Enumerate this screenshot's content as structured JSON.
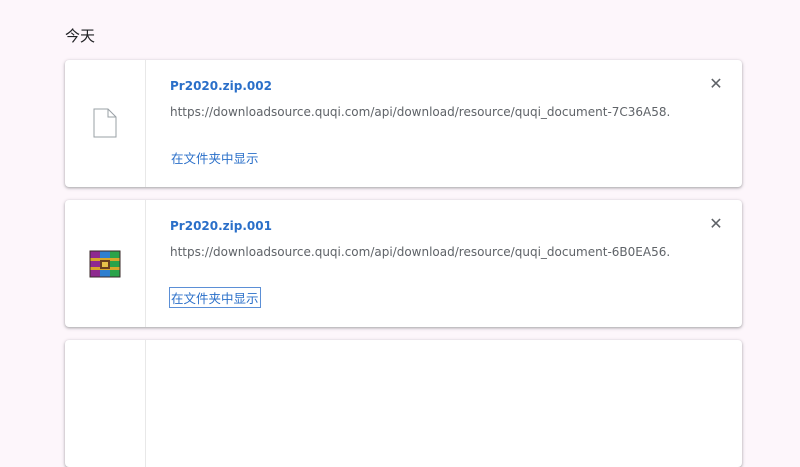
{
  "section": {
    "title": "今天"
  },
  "downloads": [
    {
      "file_name": "Pr2020.zip.002",
      "url": "https://downloadsource.quqi.com/api/download/resource/quqi_document-7C36A58...",
      "show_in_folder": "在文件夹中显示",
      "close_label": "✕",
      "icon": "generic-file-icon"
    },
    {
      "file_name": "Pr2020.zip.001",
      "url": "https://downloadsource.quqi.com/api/download/resource/quqi_document-6B0EA56...",
      "show_in_folder": "在文件夹中显示",
      "close_label": "✕",
      "icon": "winrar-archive-icon"
    }
  ],
  "colors": {
    "page_background": "#fdf6fb",
    "link": "#2a6fc9",
    "secondary_text": "#5f6368"
  }
}
